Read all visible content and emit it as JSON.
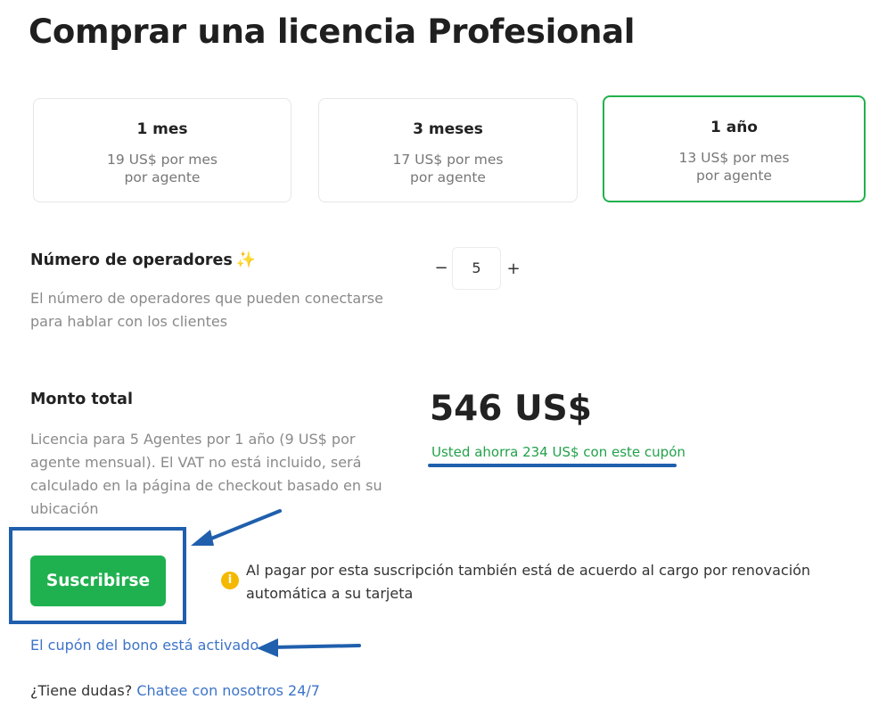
{
  "page": {
    "title": "Comprar una licencia Profesional"
  },
  "plans": [
    {
      "name": "1 mes",
      "price": "19 US$ por mes",
      "unit": "por agente",
      "selected": false
    },
    {
      "name": "3 meses",
      "price": "17 US$ por mes",
      "unit": "por agente",
      "selected": false
    },
    {
      "name": "1 año",
      "price": "13 US$ por mes",
      "unit": "por agente",
      "selected": true
    }
  ],
  "operators": {
    "label": "Número de operadores",
    "sparkle": "✨",
    "description": "El número de operadores que pueden conectarse para hablar con los clientes",
    "decrement": "−",
    "value": "5",
    "increment": "+"
  },
  "total": {
    "label": "Monto total",
    "description": "Licencia para 5 Agentes por 1 año (9 US$ por agente mensual). El VAT no está incluido, será calculado en la página de checkout basado en su ubicación",
    "amount": "546 US$",
    "savings": "Usted ahorra 234 US$ con este cupón"
  },
  "subscribe": {
    "button_label": "Suscribirse",
    "info_icon": "i",
    "notice": "Al pagar por esta suscripción también está de acuerdo al cargo por renovación automática a su tarjeta"
  },
  "coupon": {
    "link_text": "El cupón del bono está activado"
  },
  "help": {
    "question": "¿Tiene dudas? ",
    "link_text": "Chatee con nosotros 24/7"
  },
  "colors": {
    "accent_green": "#1fb14f",
    "annotation_blue": "#1f5fad",
    "link_blue": "#3d74c9"
  }
}
